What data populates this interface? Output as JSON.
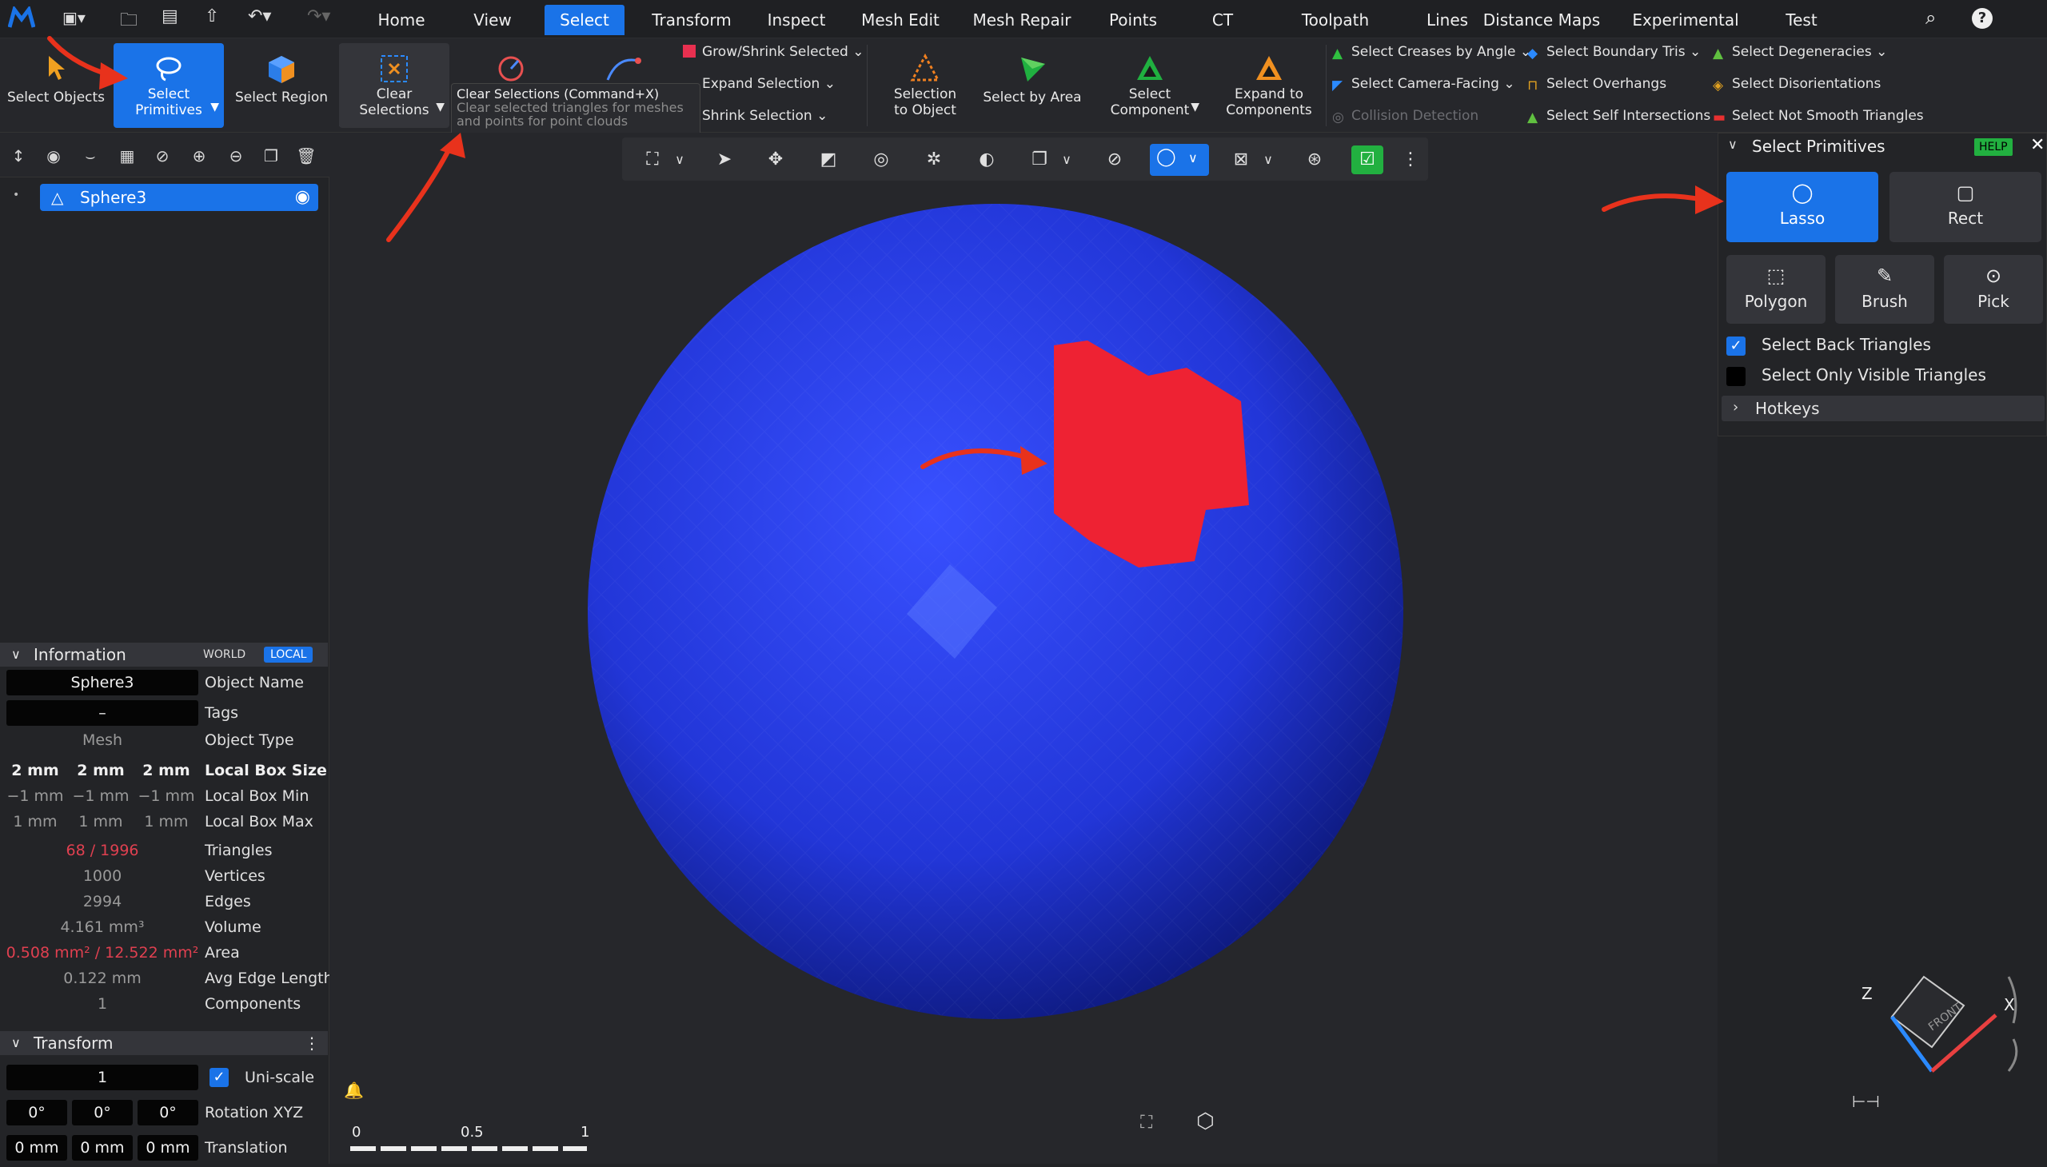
{
  "topbar": {
    "tabs": [
      "Home",
      "View",
      "Select",
      "Transform",
      "Inspect",
      "Mesh Edit",
      "Mesh Repair",
      "Points",
      "CT",
      "Toolpath",
      "Lines",
      "Distance Maps",
      "Experimental",
      "Test"
    ],
    "active": "Select"
  },
  "ribbon": {
    "select_objects": "Select Objects",
    "select_primitives": "Select\nPrimitives",
    "select_region": "Select Region",
    "clear_selections": "Clear\nSelections",
    "tooltip_title": "Clear Selections (Command+X)",
    "tooltip_desc": "Clear selected triangles for meshes and points for point clouds",
    "grow_shrink": "Grow/Shrink Selected",
    "expand_selection": "Expand Selection",
    "shrink_selection": "Shrink Selection",
    "selection_to_object": "Selection\nto Object",
    "select_by_area": "Select by Area",
    "select_component": "Select\nComponent",
    "expand_to_components": "Expand to\nComponents",
    "select_creases": "Select Creases by Angle",
    "select_camera_facing": "Select Camera-Facing",
    "collision_detection": "Collision Detection",
    "select_boundary_tris": "Select Boundary Tris",
    "select_overhangs": "Select Overhangs",
    "select_self_intersections": "Select Self Intersections",
    "select_degeneracies": "Select Degeneracies",
    "select_disorientations": "Select Disorientations",
    "select_not_smooth": "Select Not Smooth Triangles"
  },
  "scene": {
    "object": "Sphere3"
  },
  "info": {
    "title": "Information",
    "world": "WORLD",
    "local": "LOCAL",
    "object_name_value": "Sphere3",
    "object_name_label": "Object Name",
    "tags_value": "–",
    "tags_label": "Tags",
    "type_value": "Mesh",
    "type_label": "Object Type",
    "box_size": [
      "2 mm",
      "2 mm",
      "2 mm"
    ],
    "box_size_label": "Local Box Size",
    "box_min": [
      "−1 mm",
      "−1 mm",
      "−1 mm"
    ],
    "box_min_label": "Local Box Min",
    "box_max": [
      "1 mm",
      "1 mm",
      "1 mm"
    ],
    "box_max_label": "Local Box Max",
    "triangles": "68 / 1996",
    "triangles_label": "Triangles",
    "vertices": "1000",
    "vertices_label": "Vertices",
    "edges": "2994",
    "edges_label": "Edges",
    "volume": "4.161 mm³",
    "volume_label": "Volume",
    "area": "0.508 mm² / 12.522 mm²",
    "area_label": "Area",
    "avg_edge": "0.122 mm",
    "avg_edge_label": "Avg Edge Length",
    "components": "1",
    "components_label": "Components"
  },
  "transform": {
    "title": "Transform",
    "scale": "1",
    "uniscale": "Uni-scale",
    "rotation": [
      "0°",
      "0°",
      "0°"
    ],
    "rotation_label": "Rotation XYZ",
    "translation": [
      "0 mm",
      "0 mm",
      "0 mm"
    ],
    "translation_label": "Translation"
  },
  "right_panel": {
    "title": "Select Primitives",
    "help": "HELP",
    "lasso": "Lasso",
    "rect": "Rect",
    "polygon": "Polygon",
    "brush": "Brush",
    "pick": "Pick",
    "back_triangles": "Select Back Triangles",
    "only_visible": "Select Only Visible Triangles",
    "hotkeys": "Hotkeys"
  },
  "ruler": {
    "labels": [
      "0",
      "0.5",
      "1"
    ]
  },
  "gizmo": {
    "z": "Z",
    "x": "X",
    "face": "FRONT"
  },
  "colors": {
    "accent": "#1a73e8",
    "sphere": "#2a3fe0",
    "selection": "#ee2233",
    "arrow": "#e8321c"
  }
}
